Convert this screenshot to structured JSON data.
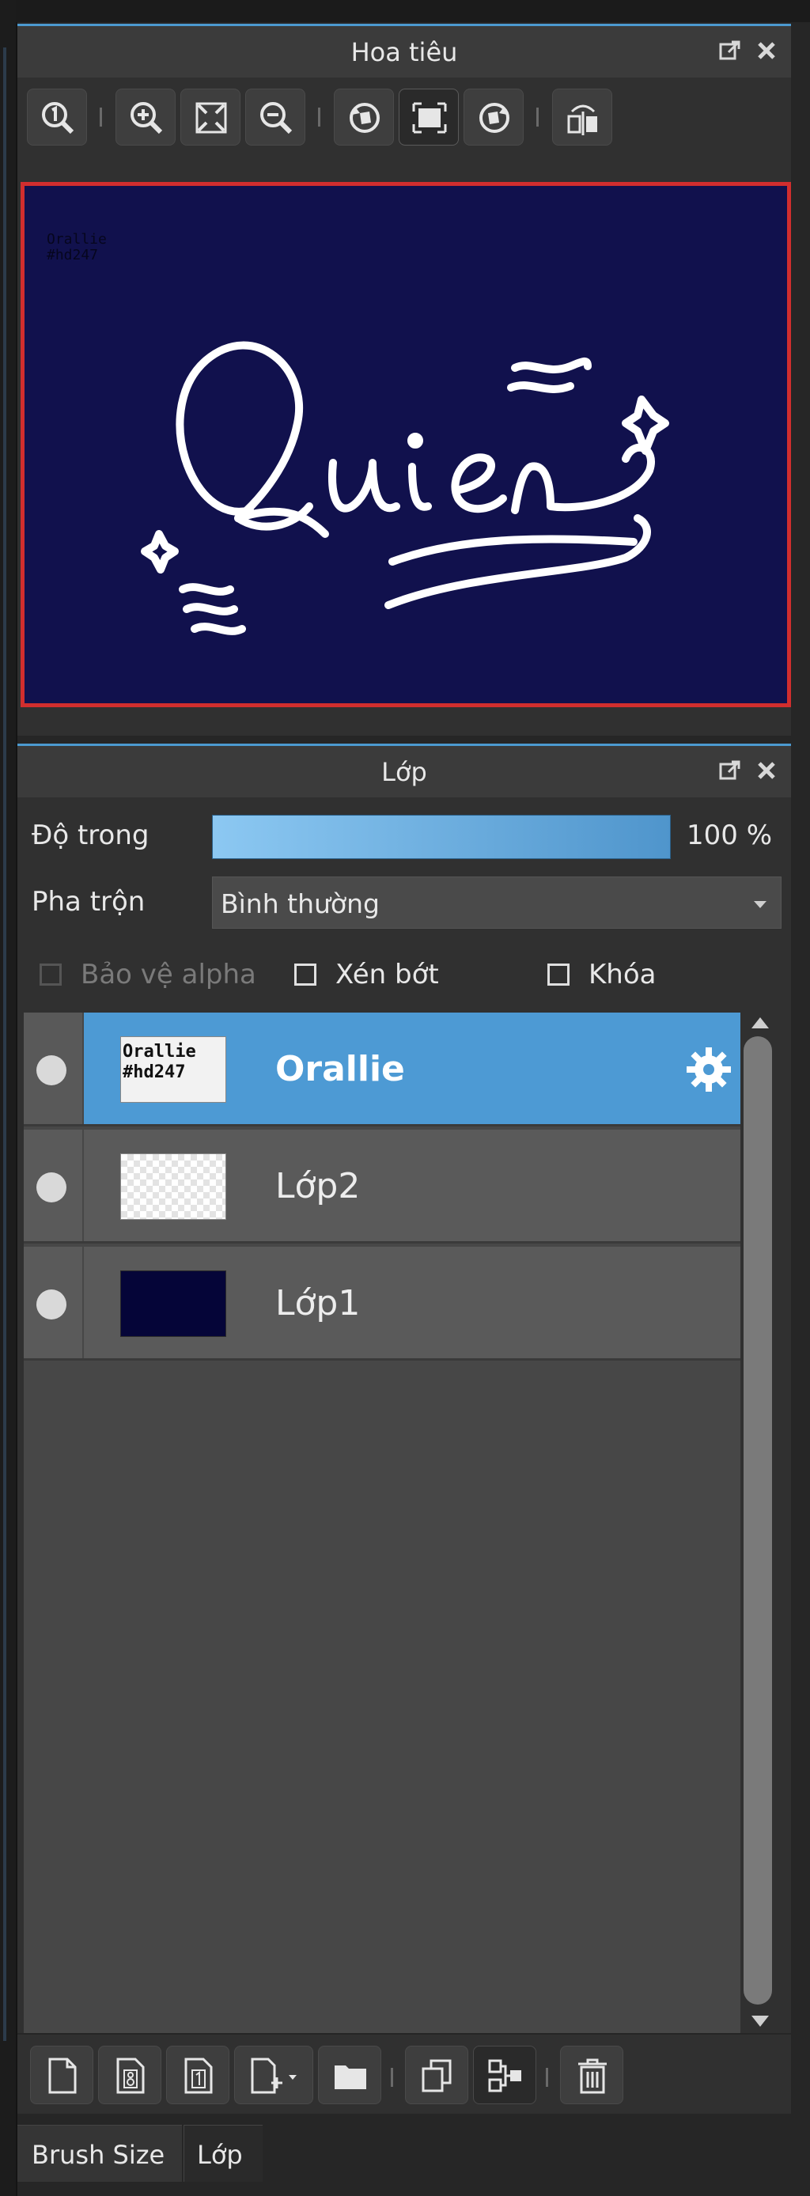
{
  "navigator": {
    "title": "Hoa tiêu",
    "tools": [
      "zoom-actual-icon",
      "zoom-in-icon",
      "fit-screen-icon",
      "zoom-out-icon",
      "rotate-left-icon",
      "fit-rotation-icon",
      "rotate-right-icon",
      "flip-horizontal-icon"
    ],
    "preview": {
      "canvas_text_line1": "Orallie",
      "canvas_text_line2": "#hd247",
      "artwork_text": "Quien",
      "background": "#11114d"
    }
  },
  "layers_panel": {
    "title": "Lớp",
    "opacity_label": "Độ trong",
    "opacity_value": "100 %",
    "opacity_fraction": 1.0,
    "blend_label": "Pha trộn",
    "blend_value": "Bình thường",
    "checkboxes": [
      {
        "label": "Bảo vệ alpha",
        "checked": false,
        "enabled": false
      },
      {
        "label": "Xén bớt",
        "checked": false,
        "enabled": true
      },
      {
        "label": "Khóa",
        "checked": false,
        "enabled": true
      }
    ],
    "layers": [
      {
        "name": "Orallie",
        "selected": true,
        "thumb_line1": "Orallie",
        "thumb_line2": "#hd247",
        "visible": true
      },
      {
        "name": "Lớp2",
        "selected": false,
        "visible": true
      },
      {
        "name": "Lớp1",
        "selected": false,
        "visible": true
      }
    ],
    "bottom_tools": [
      "new-layer-icon",
      "new-8bit-layer-icon",
      "new-1bit-layer-icon",
      "add-layer-menu-icon",
      "new-folder-icon",
      "duplicate-layer-icon",
      "merge-down-icon",
      "delete-layer-icon"
    ]
  },
  "tabs": [
    "Brush Size",
    "Lớp"
  ],
  "colors": {
    "accent": "#4d9ad4",
    "frame_red": "#d12e2e",
    "panel": "#303030"
  }
}
